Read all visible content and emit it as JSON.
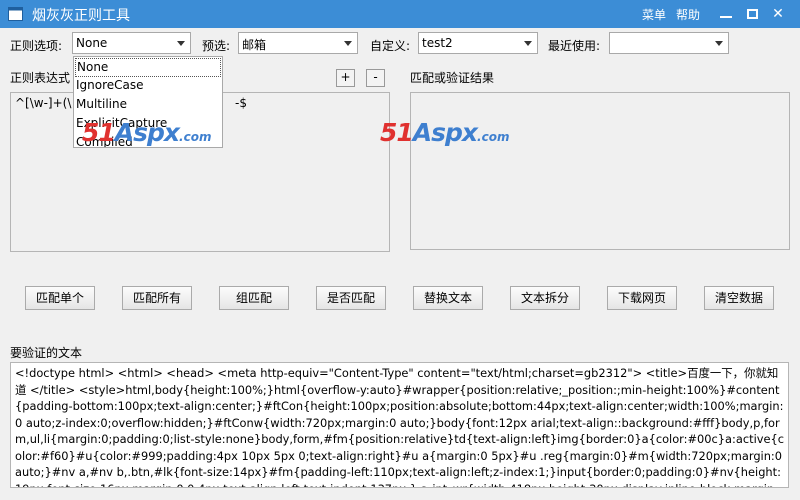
{
  "window": {
    "title": "烟灰灰正则工具",
    "menu_label": "菜单",
    "help_label": "帮助",
    "minimize": "▬",
    "maximize": "☐",
    "close": "✕"
  },
  "options": {
    "regex_options_label": "正则选项:",
    "regex_options_value": "None",
    "preset_label": "预选:",
    "preset_value": "邮箱",
    "custom_label": "自定义:",
    "custom_value": "test2",
    "recent_label": "最近使用:",
    "recent_value": ""
  },
  "dropdown": {
    "items": [
      "None",
      "IgnoreCase",
      "Multiline",
      "ExplicitCapture",
      "Compiled"
    ]
  },
  "regex_panel": {
    "label": "正则表达式",
    "add": "+",
    "remove": "-",
    "text_start": "^[\\w-]+(\\",
    "text_end": "-$"
  },
  "result_panel": {
    "label": "匹配或验证结果"
  },
  "actions": {
    "match_single": "匹配单个",
    "match_all": "匹配所有",
    "group_match": "组匹配",
    "is_match": "是否匹配",
    "replace_text": "替换文本",
    "split_text": "文本拆分",
    "download_page": "下载网页",
    "clear_data": "清空数据"
  },
  "verify": {
    "label": "要验证的文本",
    "text": "<!doctype html> <html> <head> <meta http-equiv=\"Content-Type\" content=\"text/html;charset=gb2312\"> <title>百度一下，你就知道 </title> <style>html,body{height:100%;}html{overflow-y:auto}#wrapper{position:relative;_position:;min-height:100%}#content{padding-bottom:100px;text-align:center;}#ftCon{height:100px;position:absolute;bottom:44px;text-align:center;width:100%;margin:0 auto;z-index:0;overflow:hidden;}#ftConw{width:720px;margin:0 auto;}body{font:12px arial;text-align::background:#fff}body,p,form,ul,li{margin:0;padding:0;list-style:none}body,form,#fm{position:relative}td{text-align:left}img{border:0}a{color:#00c}a:active{color:#f60}#u{color:#999;padding:4px 10px 5px 0;text-align:right}#u a{margin:0 5px}#u .reg{margin:0}#m{width:720px;margin:0 auto;}#nv a,#nv b,.btn,#lk{font-size:14px}#fm{padding-left:110px;text-align:left;z-index:1;}input{border:0;padding:0}#nv{height:19px;font-size:16px;margin:0 0 4px;text-align:left;text-indent:137px;}.s_ipt_wr{width:418px;height:30px;display:inline-block;margin-"
  },
  "watermark": {
    "prefix": "51",
    "brand": "Aspx",
    "suffix": ".com"
  },
  "colors": {
    "titlebar": "#3c8dd6",
    "watermark_red": "#e0312f",
    "watermark_blue": "#3e7fcf"
  }
}
